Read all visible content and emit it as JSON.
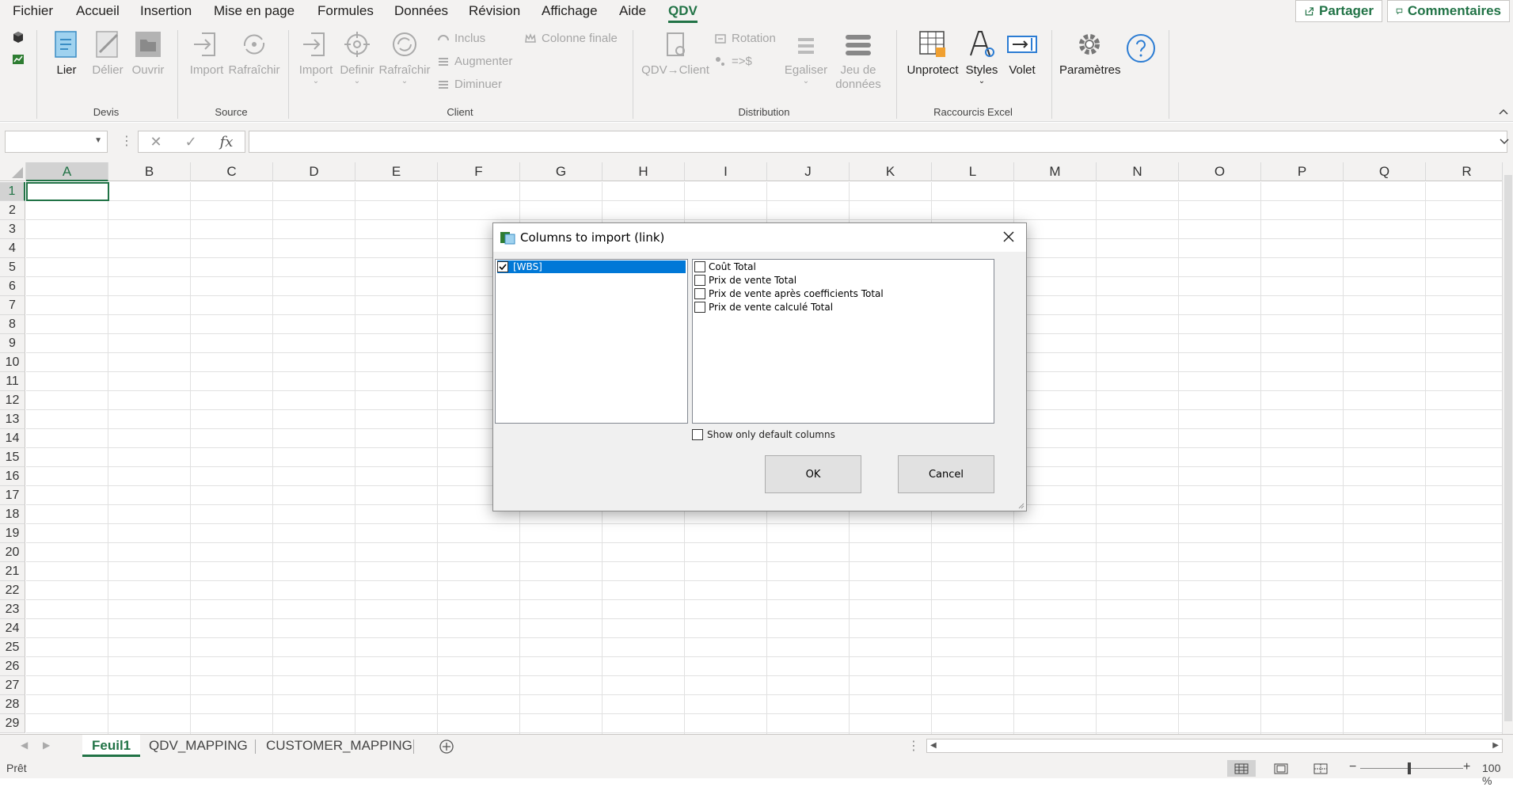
{
  "menu": {
    "tabs": [
      "Fichier",
      "Accueil",
      "Insertion",
      "Mise en page",
      "Formules",
      "Données",
      "Révision",
      "Affichage",
      "Aide",
      "QDV"
    ],
    "active_tab": "QDV",
    "share_label": "Partager",
    "comments_label": "Commentaires"
  },
  "ribbon": {
    "devis": {
      "label": "Devis",
      "lier": "Lier",
      "delier": "Délier",
      "ouvrir": "Ouvrir"
    },
    "source": {
      "label": "Source",
      "import": "Import",
      "rafraichir": "Rafraîchir"
    },
    "client": {
      "label": "Client",
      "import": "Import",
      "definir": "Definir",
      "rafraichir": "Rafraîchir",
      "inclus": "Inclus",
      "augmenter": "Augmenter",
      "diminuer": "Diminuer",
      "colonne_finale": "Colonne finale"
    },
    "distribution": {
      "label": "Distribution",
      "qdv_client": "QDV→Client",
      "rotation": "Rotation",
      "to_dollar": "=>$",
      "egaliser": "Egaliser",
      "jeu_de": "Jeu de",
      "donnees": "données"
    },
    "raccourcis": {
      "label": "Raccourcis Excel",
      "unprotect": "Unprotect",
      "styles": "Styles",
      "volet": "Volet"
    },
    "parametres": "Paramètres"
  },
  "formula_bar": {
    "name_box": "",
    "formula": "",
    "fx_label": "fx"
  },
  "grid": {
    "columns": [
      "A",
      "B",
      "C",
      "D",
      "E",
      "F",
      "G",
      "H",
      "I",
      "J",
      "K",
      "L",
      "M",
      "N",
      "O",
      "P",
      "Q",
      "R"
    ],
    "rows": [
      "1",
      "2",
      "3",
      "4",
      "5",
      "6",
      "7",
      "8",
      "9",
      "10",
      "11",
      "12",
      "13",
      "14",
      "15",
      "16",
      "17",
      "18",
      "19",
      "20",
      "21",
      "22",
      "23",
      "24",
      "25",
      "26",
      "27",
      "28",
      "29"
    ],
    "active_cell": "A1"
  },
  "sheets": {
    "tabs": [
      "Feuil1",
      "QDV_MAPPING",
      "CUSTOMER_MAPPING"
    ],
    "active": "Feuil1"
  },
  "status": {
    "text": "Prêt",
    "zoom": "100 %"
  },
  "dialog": {
    "title": "Columns to import (link)",
    "left_items": [
      {
        "label": "[WBS]",
        "checked": true,
        "selected": true
      }
    ],
    "right_items": [
      {
        "label": "Coût Total",
        "checked": false
      },
      {
        "label": "Prix de vente Total",
        "checked": false
      },
      {
        "label": "Prix de vente après coefficients Total",
        "checked": false
      },
      {
        "label": "Prix de vente calculé Total",
        "checked": false
      }
    ],
    "show_default_label": "Show only default columns",
    "show_default_checked": false,
    "ok_label": "OK",
    "cancel_label": "Cancel"
  },
  "colors": {
    "accent": "#217346",
    "selection": "#0078d7"
  }
}
